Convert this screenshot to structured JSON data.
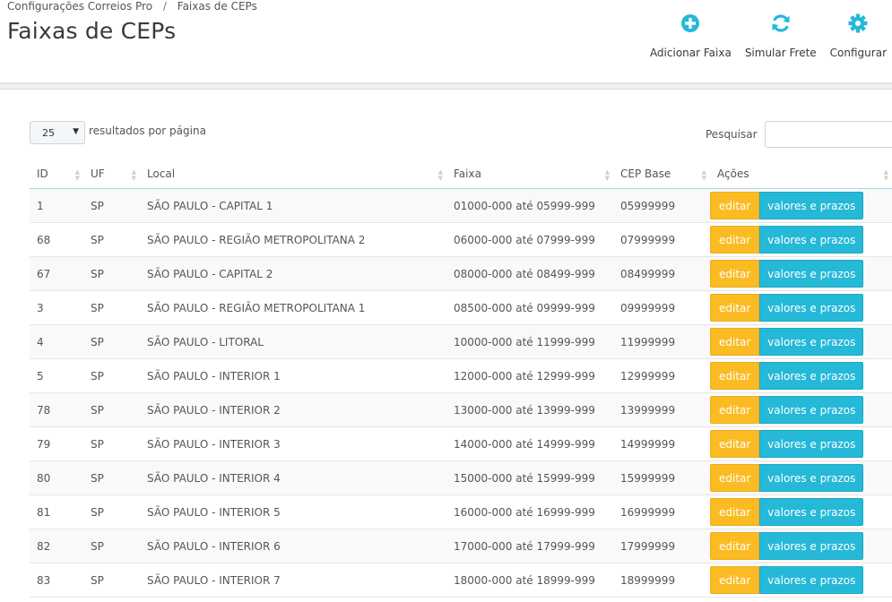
{
  "breadcrumb": {
    "items": [
      "Configurações Correios Pro",
      "Faixas de CEPs"
    ],
    "separator": "/"
  },
  "page": {
    "title": "Faixas de CEPs"
  },
  "toolbar": {
    "buttons": [
      {
        "label": "Adicionar Faixa",
        "icon": "plus-circle-icon"
      },
      {
        "label": "Simular Frete",
        "icon": "refresh-icon"
      },
      {
        "label": "Configurar",
        "icon": "gear-icon"
      }
    ]
  },
  "colors": {
    "accent": "#25b9d7",
    "edit": "#fbbb22",
    "text": "#555555",
    "title": "#363a41"
  },
  "controls": {
    "per_page_value": "25",
    "per_page_label": "resultados por página",
    "search_label": "Pesquisar",
    "search_value": ""
  },
  "table": {
    "columns": [
      "ID",
      "UF",
      "Local",
      "Faixa",
      "CEP Base",
      "Ações"
    ],
    "action_labels": {
      "edit": "editar",
      "values": "valores e prazos"
    },
    "rows": [
      {
        "id": "1",
        "uf": "SP",
        "local": "SÃO PAULO - CAPITAL 1",
        "faixa": "01000-000 até 05999-999",
        "cep_base": "05999999"
      },
      {
        "id": "68",
        "uf": "SP",
        "local": "SÃO PAULO - REGIÃO METROPOLITANA 2",
        "faixa": "06000-000 até 07999-999",
        "cep_base": "07999999"
      },
      {
        "id": "67",
        "uf": "SP",
        "local": "SÃO PAULO - CAPITAL 2",
        "faixa": "08000-000 até 08499-999",
        "cep_base": "08499999"
      },
      {
        "id": "3",
        "uf": "SP",
        "local": "SÃO PAULO - REGIÃO METROPOLITANA 1",
        "faixa": "08500-000 até 09999-999",
        "cep_base": "09999999"
      },
      {
        "id": "4",
        "uf": "SP",
        "local": "SÃO PAULO - LITORAL",
        "faixa": "10000-000 até 11999-999",
        "cep_base": "11999999"
      },
      {
        "id": "5",
        "uf": "SP",
        "local": "SÃO PAULO - INTERIOR 1",
        "faixa": "12000-000 até 12999-999",
        "cep_base": "12999999"
      },
      {
        "id": "78",
        "uf": "SP",
        "local": "SÃO PAULO - INTERIOR 2",
        "faixa": "13000-000 até 13999-999",
        "cep_base": "13999999"
      },
      {
        "id": "79",
        "uf": "SP",
        "local": "SÃO PAULO - INTERIOR 3",
        "faixa": "14000-000 até 14999-999",
        "cep_base": "14999999"
      },
      {
        "id": "80",
        "uf": "SP",
        "local": "SÃO PAULO - INTERIOR 4",
        "faixa": "15000-000 até 15999-999",
        "cep_base": "15999999"
      },
      {
        "id": "81",
        "uf": "SP",
        "local": "SÃO PAULO - INTERIOR 5",
        "faixa": "16000-000 até 16999-999",
        "cep_base": "16999999"
      },
      {
        "id": "82",
        "uf": "SP",
        "local": "SÃO PAULO - INTERIOR 6",
        "faixa": "17000-000 até 17999-999",
        "cep_base": "17999999"
      },
      {
        "id": "83",
        "uf": "SP",
        "local": "SÃO PAULO - INTERIOR 7",
        "faixa": "18000-000 até 18999-999",
        "cep_base": "18999999"
      }
    ]
  }
}
